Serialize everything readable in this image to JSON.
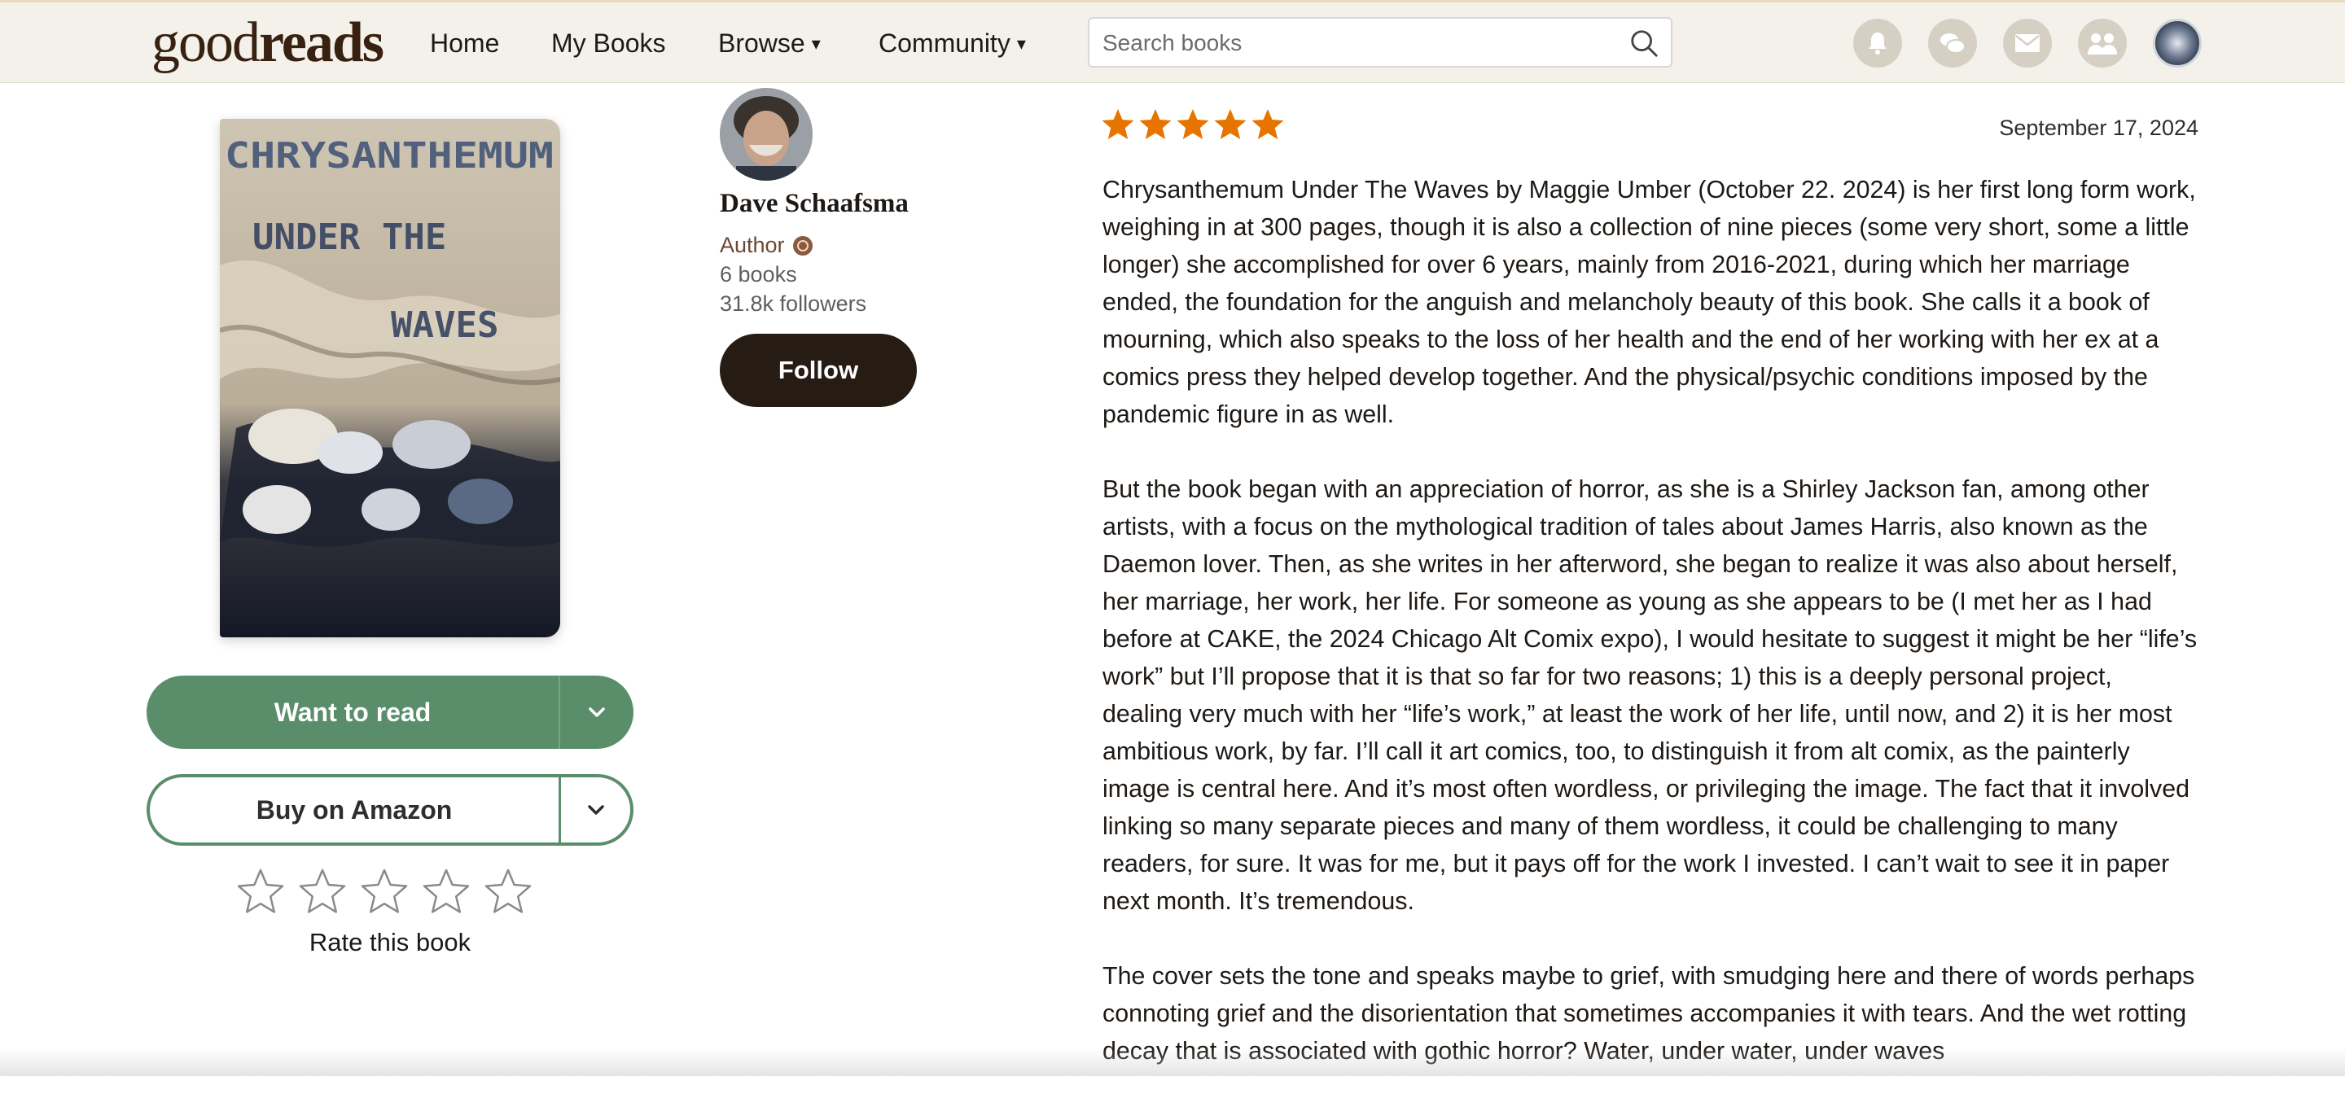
{
  "header": {
    "logo_light": "good",
    "logo_bold": "reads",
    "nav": [
      {
        "label": "Home"
      },
      {
        "label": "My Books"
      },
      {
        "label": "Browse"
      },
      {
        "label": "Community"
      }
    ],
    "search": {
      "placeholder": "Search books"
    },
    "icons": [
      "notifications-icon",
      "discussions-icon",
      "messages-icon",
      "friends-icon",
      "profile-avatar"
    ]
  },
  "book": {
    "cover_title_lines": [
      "CHRYSANTHEMUM",
      "UNDER THE",
      "WAVES"
    ],
    "want_to_read": "Want to read",
    "buy": "Buy on Amazon",
    "rate_label": "Rate this book",
    "rating_user": 0
  },
  "author": {
    "name": "Dave Schaafsma",
    "role": "Author",
    "books": "6 books",
    "followers": "31.8k followers",
    "follow_label": "Follow"
  },
  "review": {
    "rating": 5,
    "date": "September 17, 2024",
    "paragraphs": [
      "Chrysanthemum Under The Waves by Maggie Umber (October 22. 2024) is her first long form work, weighing in at 300 pages, though it is also a collection of nine pieces (some very short, some a little longer) she accomplished for over 6 years, mainly from 2016-2021, during which her marriage ended, the foundation for the anguish and melancholy beauty of this book. She calls it a book of mourning, which also speaks to the loss of her health and the end of her working with her ex at a comics press they helped develop together. And the physical/psychic conditions imposed by the pandemic figure in as well.",
      "But the book began with an appreciation of horror, as she is a Shirley Jackson fan, among other artists, with a focus on the mythological tradition of tales about James Harris, also known as the Daemon lover. Then, as she writes in her afterword, she began to realize it was also about herself, her marriage, her work, her life. For someone as young as she appears to be (I met her as I had before at CAKE, the 2024 Chicago Alt Comix expo), I would hesitate to suggest it might be her “life’s work” but I’ll propose that it is that so far for two reasons; 1) this is a deeply personal project, dealing very much with her “life’s work,” at least the work of her life, until now, and 2) it is her most ambitious work, by far. I’ll call it art comics, too, to distinguish it from alt comix, as the painterly image is central here. And it’s most often wordless, or privileging the image. The fact that it involved linking so many separate pieces and many of them wordless, it could be challenging to many readers, for sure. It was for me, but it pays off for the work I invested. I can’t wait to see it in paper next month. It’s tremendous.",
      "The cover sets the tone and speaks maybe to grief, with smudging here and there of words perhaps connoting grief and the disorientation that sometimes accompanies it with tears. And the wet rotting decay that is associated with gothic horror? Water, under water, under waves"
    ]
  },
  "colors": {
    "header_bg": "#f4f1ea",
    "want_green": "#5a8e6b",
    "star_orange": "#e87400",
    "follow_dark": "#271c14"
  }
}
